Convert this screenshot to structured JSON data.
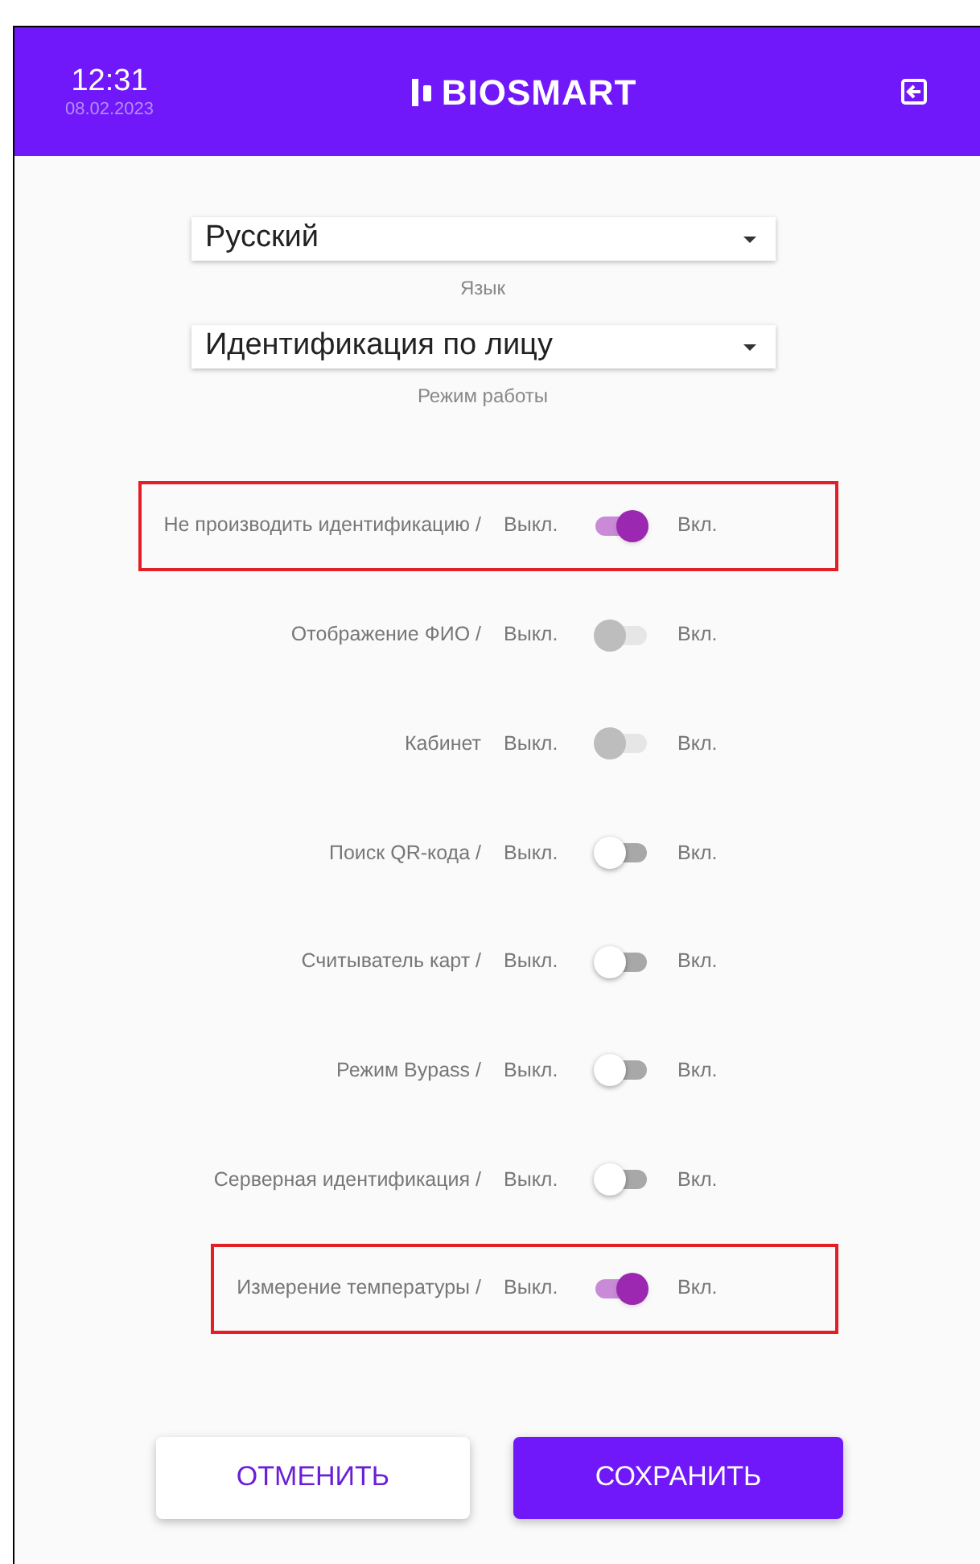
{
  "header": {
    "time": "12:31",
    "date": "08.02.2023",
    "logo_text": "BIOSMART"
  },
  "selects": [
    {
      "value": "Русский",
      "label": "Язык"
    },
    {
      "value": "Идентификация по лицу",
      "label": "Режим работы"
    }
  ],
  "settings": [
    {
      "label": "Не производить идентификацию /",
      "off_text": "Выкл.",
      "on_text": "Вкл.",
      "checked": true,
      "disabled": false,
      "highlighted": true
    },
    {
      "label": "Отображение ФИО /",
      "off_text": "Выкл.",
      "on_text": "Вкл.",
      "checked": false,
      "disabled": true,
      "highlighted": false
    },
    {
      "label": "Кабинет",
      "off_text": "Выкл.",
      "on_text": "Вкл.",
      "checked": false,
      "disabled": true,
      "highlighted": false
    },
    {
      "label": "Поиск QR-кода /",
      "off_text": "Выкл.",
      "on_text": "Вкл.",
      "checked": false,
      "disabled": false,
      "highlighted": false
    },
    {
      "label": "Считыватель карт /",
      "off_text": "Выкл.",
      "on_text": "Вкл.",
      "checked": false,
      "disabled": false,
      "highlighted": false
    },
    {
      "label": "Режим Bypass /",
      "off_text": "Выкл.",
      "on_text": "Вкл.",
      "checked": false,
      "disabled": false,
      "highlighted": false
    },
    {
      "label": "Серверная идентификация /",
      "off_text": "Выкл.",
      "on_text": "Вкл.",
      "checked": false,
      "disabled": false,
      "highlighted": false
    },
    {
      "label": "Измерение температуры /",
      "off_text": "Выкл.",
      "on_text": "Вкл.",
      "checked": true,
      "disabled": false,
      "highlighted": true
    }
  ],
  "buttons": [
    {
      "kind": "secondary",
      "label": "ОТМЕНИТЬ"
    },
    {
      "kind": "primary",
      "label": "СОХРАНИТЬ"
    }
  ]
}
